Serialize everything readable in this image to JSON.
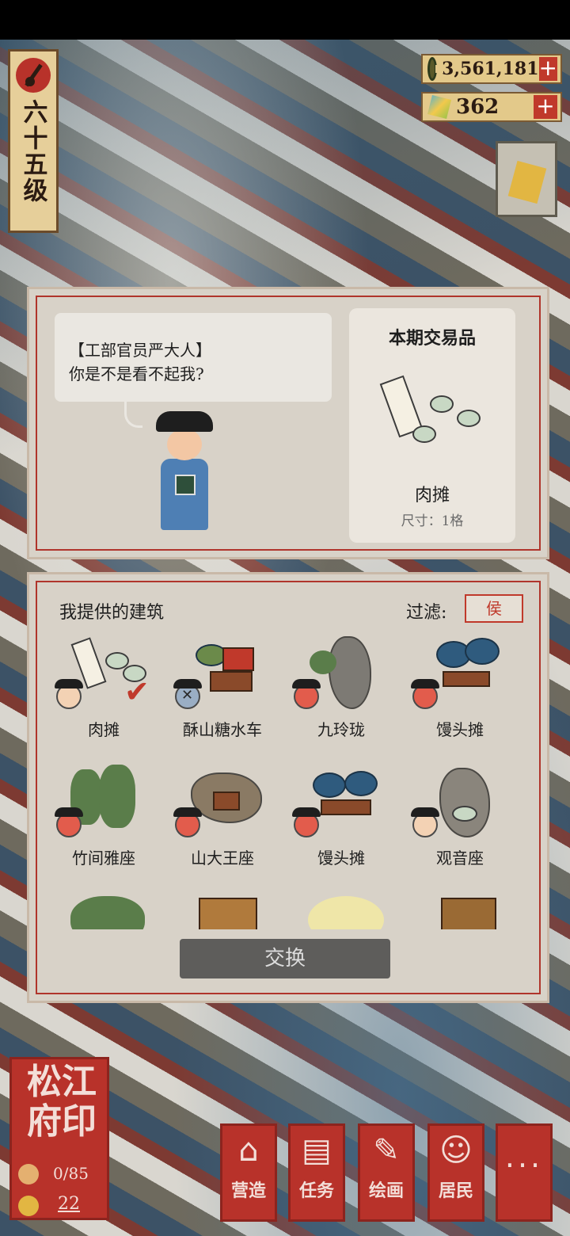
{
  "player": {
    "level_label": "六十五级"
  },
  "currency": {
    "coins": "3,561,181",
    "jade": "362"
  },
  "trade": {
    "dialog_speaker": "【工部官员严大人】",
    "dialog_text": "你是不是看不起我?",
    "item_title": "本期交易品",
    "item_name": "肉摊",
    "item_size": "尺寸：1格"
  },
  "offer": {
    "heading": "我提供的建筑",
    "filter_label": "过滤:",
    "filter_value": "侯",
    "buildings": [
      {
        "name": "肉摊",
        "npc": "sad",
        "selected": true
      },
      {
        "name": "酥山糖水车",
        "npc": "unavailable",
        "selected": false
      },
      {
        "name": "九玲珑",
        "npc": "happy",
        "selected": false
      },
      {
        "name": "馒头摊",
        "npc": "happy",
        "selected": false
      },
      {
        "name": "竹间雅座",
        "npc": "happy",
        "selected": false
      },
      {
        "name": "山大王座",
        "npc": "happy",
        "selected": false
      },
      {
        "name": "馒头摊",
        "npc": "happy",
        "selected": false
      },
      {
        "name": "观音座",
        "npc": "sad",
        "selected": false
      }
    ],
    "exchange_label": "交换"
  },
  "seal": {
    "title": "松江府印",
    "residents": "0/85",
    "level": "22"
  },
  "nav": {
    "build_label": "营造",
    "task_label": "任务",
    "paint_label": "绘画",
    "resident_label": "居民",
    "more_label": "···"
  },
  "colors": {
    "accent_red": "#b8322a",
    "panel_bg": "#d8d2c8",
    "button_gray": "#5e5d5b"
  }
}
